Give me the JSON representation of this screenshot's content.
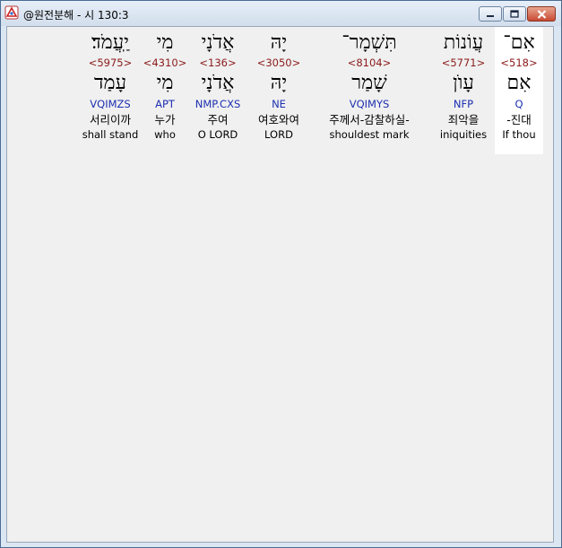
{
  "window": {
    "title": "@원전분해 - 시 130:3",
    "icon": "app-logo-icon",
    "controls": [
      "minimize-icon",
      "maximize-icon",
      "close-icon"
    ]
  },
  "colors": {
    "strong_number": "#8b1a1a",
    "parsing": "#1c2fb0",
    "selected_bg": "#ffffff",
    "client_bg": "#f0f0f0"
  },
  "words": [
    {
      "surface": "יַֽעֲמֹד׃",
      "strong": "<5975>",
      "lemma": "עָמַד",
      "parse": "VQIMZS",
      "korean": "서리이까",
      "english": "shall stand"
    },
    {
      "surface": "מִי",
      "strong": "<4310>",
      "lemma": "מִי",
      "parse": "APT",
      "korean": "누가",
      "english": "who"
    },
    {
      "surface": "אֲדֹנָי",
      "strong": "<136>",
      "lemma": "אֲדֹנָי",
      "parse": "NMP.CXS",
      "korean": "주여",
      "english": "O LORD"
    },
    {
      "surface": "יָהּ",
      "strong": "<3050>",
      "lemma": "יָהּ",
      "parse": "NE",
      "korean": "여호와여",
      "english": "LORD"
    },
    {
      "surface": "תִּשְׁמָר־",
      "strong": "<8104>",
      "lemma": "שָׁמַר",
      "parse": "VQIMYS",
      "korean": "주께서-감찰하실-",
      "english": "shouldest mark"
    },
    {
      "surface": "עֲוֹנוֹת",
      "strong": "<5771>",
      "lemma": "עָוֺן",
      "parse": "NFP",
      "korean": "죄악을",
      "english": "iniquities"
    },
    {
      "surface": "אִם־",
      "strong": "<518>",
      "lemma": "אִם",
      "parse": "Q",
      "korean": "-진대",
      "english": "If thou",
      "selected": true
    }
  ]
}
